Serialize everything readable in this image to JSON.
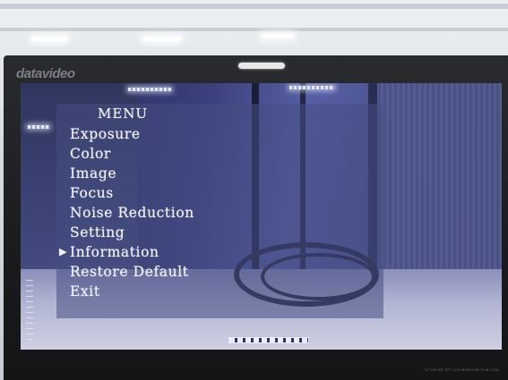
{
  "monitor": {
    "brand": "datavideo",
    "model": "17\" HD/SD TFT LCD MONITOR  TLM-170H"
  },
  "osd_menu": {
    "title": "MENU",
    "items": [
      {
        "label": "Exposure",
        "selected": false
      },
      {
        "label": "Color",
        "selected": false
      },
      {
        "label": "Image",
        "selected": false
      },
      {
        "label": "Focus",
        "selected": false
      },
      {
        "label": "Noise Reduction",
        "selected": false
      },
      {
        "label": "Setting",
        "selected": false
      },
      {
        "label": "Information",
        "selected": true
      },
      {
        "label": "Restore Default",
        "selected": false
      },
      {
        "label": "Exit",
        "selected": false
      }
    ],
    "cursor": "▶"
  },
  "colors": {
    "osd_text": "#f2f3fb",
    "bezel": "#1f2022",
    "screen_tint": "#3a3e7a"
  }
}
